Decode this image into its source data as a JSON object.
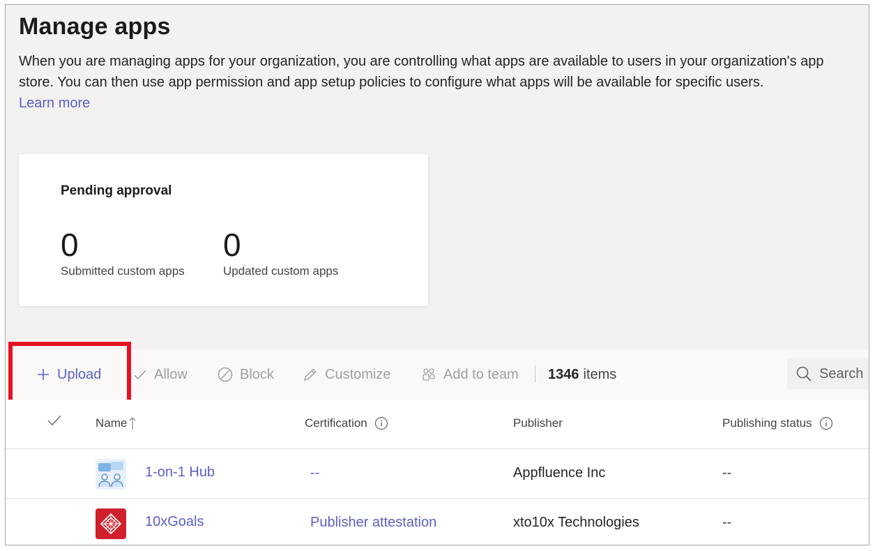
{
  "page": {
    "title": "Manage apps",
    "description": "When you are managing apps for your organization, you are controlling what apps are available to users in your organization's app store. You can then use app permission and app setup policies to configure what apps will be available for specific users.",
    "learn_more": "Learn more"
  },
  "pending": {
    "title": "Pending approval",
    "submitted_count": "0",
    "submitted_label": "Submitted custom apps",
    "updated_count": "0",
    "updated_label": "Updated custom apps"
  },
  "toolbar": {
    "upload": "Upload",
    "allow": "Allow",
    "block": "Block",
    "customize": "Customize",
    "add_to_team": "Add to team",
    "count": "1346",
    "count_suffix": "items",
    "search_placeholder": "Search"
  },
  "table": {
    "columns": {
      "name": "Name",
      "certification": "Certification",
      "publisher": "Publisher",
      "publishing_status": "Publishing status"
    },
    "rows": [
      {
        "name": "1-on-1 Hub",
        "certification": "--",
        "publisher": "Appfluence Inc",
        "status": "--",
        "icon": "people-chat-icon"
      },
      {
        "name": "10xGoals",
        "certification": "Publisher attestation",
        "publisher": "xto10x Technologies",
        "status": "--",
        "icon": "red-diamond-logo-icon"
      }
    ]
  },
  "colors": {
    "accent": "#5b5fc7",
    "highlight": "#e81123",
    "background": "#f3f2f1"
  }
}
